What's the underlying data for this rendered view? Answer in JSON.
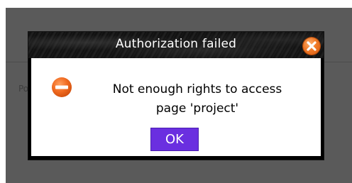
{
  "background": {
    "text_left": "Po",
    "text_right": "."
  },
  "dialog": {
    "title": "Authorization failed",
    "message_line1": "Not enough rights to access",
    "message_line2": "page 'project'",
    "ok_label": "OK",
    "close_icon": "close-icon",
    "error_icon": "error-icon"
  },
  "colors": {
    "backdrop": "#5a5a5a",
    "titlebar": "#111111",
    "ok_button": "#6a2fe0",
    "close_button": "#f07a28",
    "error_icon": "#f06a20"
  }
}
